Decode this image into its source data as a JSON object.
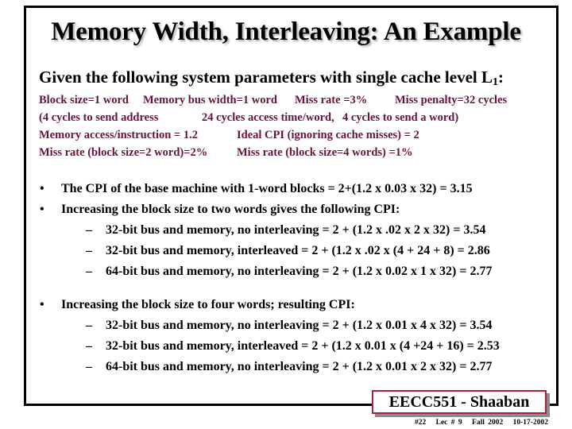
{
  "slide": {
    "title": "Memory Width, Interleaving: An Example",
    "given": {
      "prefix": "Given the following system parameters with single cache level L",
      "subscript": "1",
      "suffix": ":"
    },
    "parameters": [
      [
        "Block size=1 word",
        "Memory bus width=1  word",
        "Miss rate =3%",
        "Miss penalty=32 cycles"
      ],
      [
        "(4 cycles to send address",
        "24 cycles  access time/word,",
        "4 cycles to send a word)"
      ],
      [
        "Memory access/instruction = 1.2",
        "Ideal CPI (ignoring cache misses) = 2"
      ],
      [
        "Miss rate (block size=2 word)=2%",
        "Miss rate (block size=4 words) =1%"
      ]
    ],
    "bullets": [
      {
        "text": "The CPI of the base machine with 1-word blocks = 2+(1.2 x 0.03 x 32) = 3.15",
        "sub": []
      },
      {
        "text": "Increasing the block size to two words gives the following CPI:",
        "sub": [
          "32-bit bus and memory, no interleaving = 2 + (1.2 x  .02 x 2 x 32) = 3.54",
          "32-bit bus and memory, interleaved = 2 + (1.2 x .02 x (4 + 24 + 8) = 2.86",
          "64-bit bus and memory, no interleaving = 2 + (1.2 x 0.02 x 1 x 32) = 2.77"
        ]
      },
      {
        "text": "Increasing the block size to four words; resulting CPI:",
        "sub": [
          "32-bit bus and memory, no interleaving = 2 + (1.2 x 0.01 x 4 x 32) = 3.54",
          "32-bit bus and memory, interleaved = 2 + (1.2 x 0.01 x (4 +24 + 16) = 2.53",
          "64-bit bus and memory, no interleaving = 2 + (1.2 x 0.01 x 2 x 32) = 2.77"
        ]
      }
    ],
    "bullet_glyph": "•",
    "dash_glyph": "–"
  },
  "badge": {
    "label": "EECC551 - Shaaban"
  },
  "footer": {
    "slide_number": "#22",
    "lecture": "Lec # 9",
    "term": "Fall 2002",
    "date": "10-17-2002"
  },
  "colors": {
    "param_text": "#6b1040",
    "badge_border": "#a3243c",
    "badge_shadow": "#8a8a8a",
    "title_shadow": "#b0b0b0"
  }
}
